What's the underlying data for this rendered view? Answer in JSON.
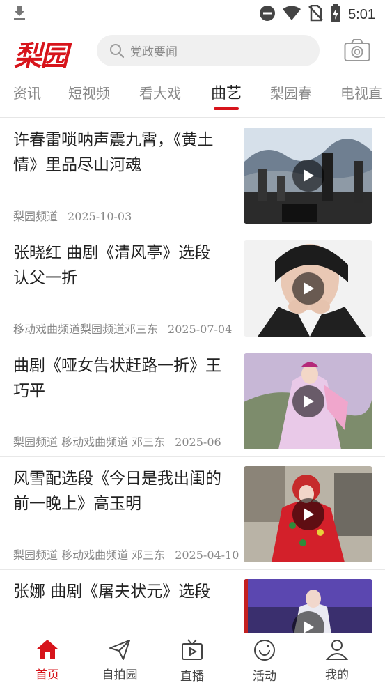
{
  "status_bar": {
    "time": "5:01",
    "icons": [
      "download-icon",
      "dnd-icon",
      "wifi-icon",
      "no-sim-icon",
      "battery-charging-icon"
    ]
  },
  "header": {
    "logo_text": "梨园",
    "search_placeholder": "党政要闻",
    "camera_icon": "camera-icon"
  },
  "tabs": [
    {
      "label": "资讯"
    },
    {
      "label": "短视频"
    },
    {
      "label": "看大戏"
    },
    {
      "label": "曲艺",
      "active": true
    },
    {
      "label": "梨园春"
    },
    {
      "label": "电视直"
    }
  ],
  "news": [
    {
      "title": "许春雷唢呐声震九霄，《黄土情》里品尽山河魂",
      "source": "梨园频道",
      "date": "2025-10-03"
    },
    {
      "title": "张晓红 曲剧《清风亭》选段 认父一折",
      "source": "移动戏曲频道梨园频道邓三东",
      "date": "2025-07-04"
    },
    {
      "title": "曲剧《哑女告状赶路一折》王巧平",
      "source": "梨园频道  移动戏曲频道 邓三东",
      "date": "2025-06"
    },
    {
      "title": "风雪配选段《今日是我出闺的前一晚上》高玉明",
      "source": "梨园频道  移动戏曲频道 邓三东",
      "date": "2025-04-10"
    },
    {
      "title": "张娜  曲剧《屠夫状元》选段",
      "source": "",
      "date": ""
    }
  ],
  "bottom_nav": [
    {
      "label": "首页",
      "icon": "home-icon",
      "active": true
    },
    {
      "label": "自拍园",
      "icon": "send-icon"
    },
    {
      "label": "直播",
      "icon": "tv-play-icon"
    },
    {
      "label": "活动",
      "icon": "activity-icon"
    },
    {
      "label": "我的",
      "icon": "user-icon"
    }
  ],
  "colors": {
    "accent": "#d7141b",
    "muted": "#888888"
  }
}
